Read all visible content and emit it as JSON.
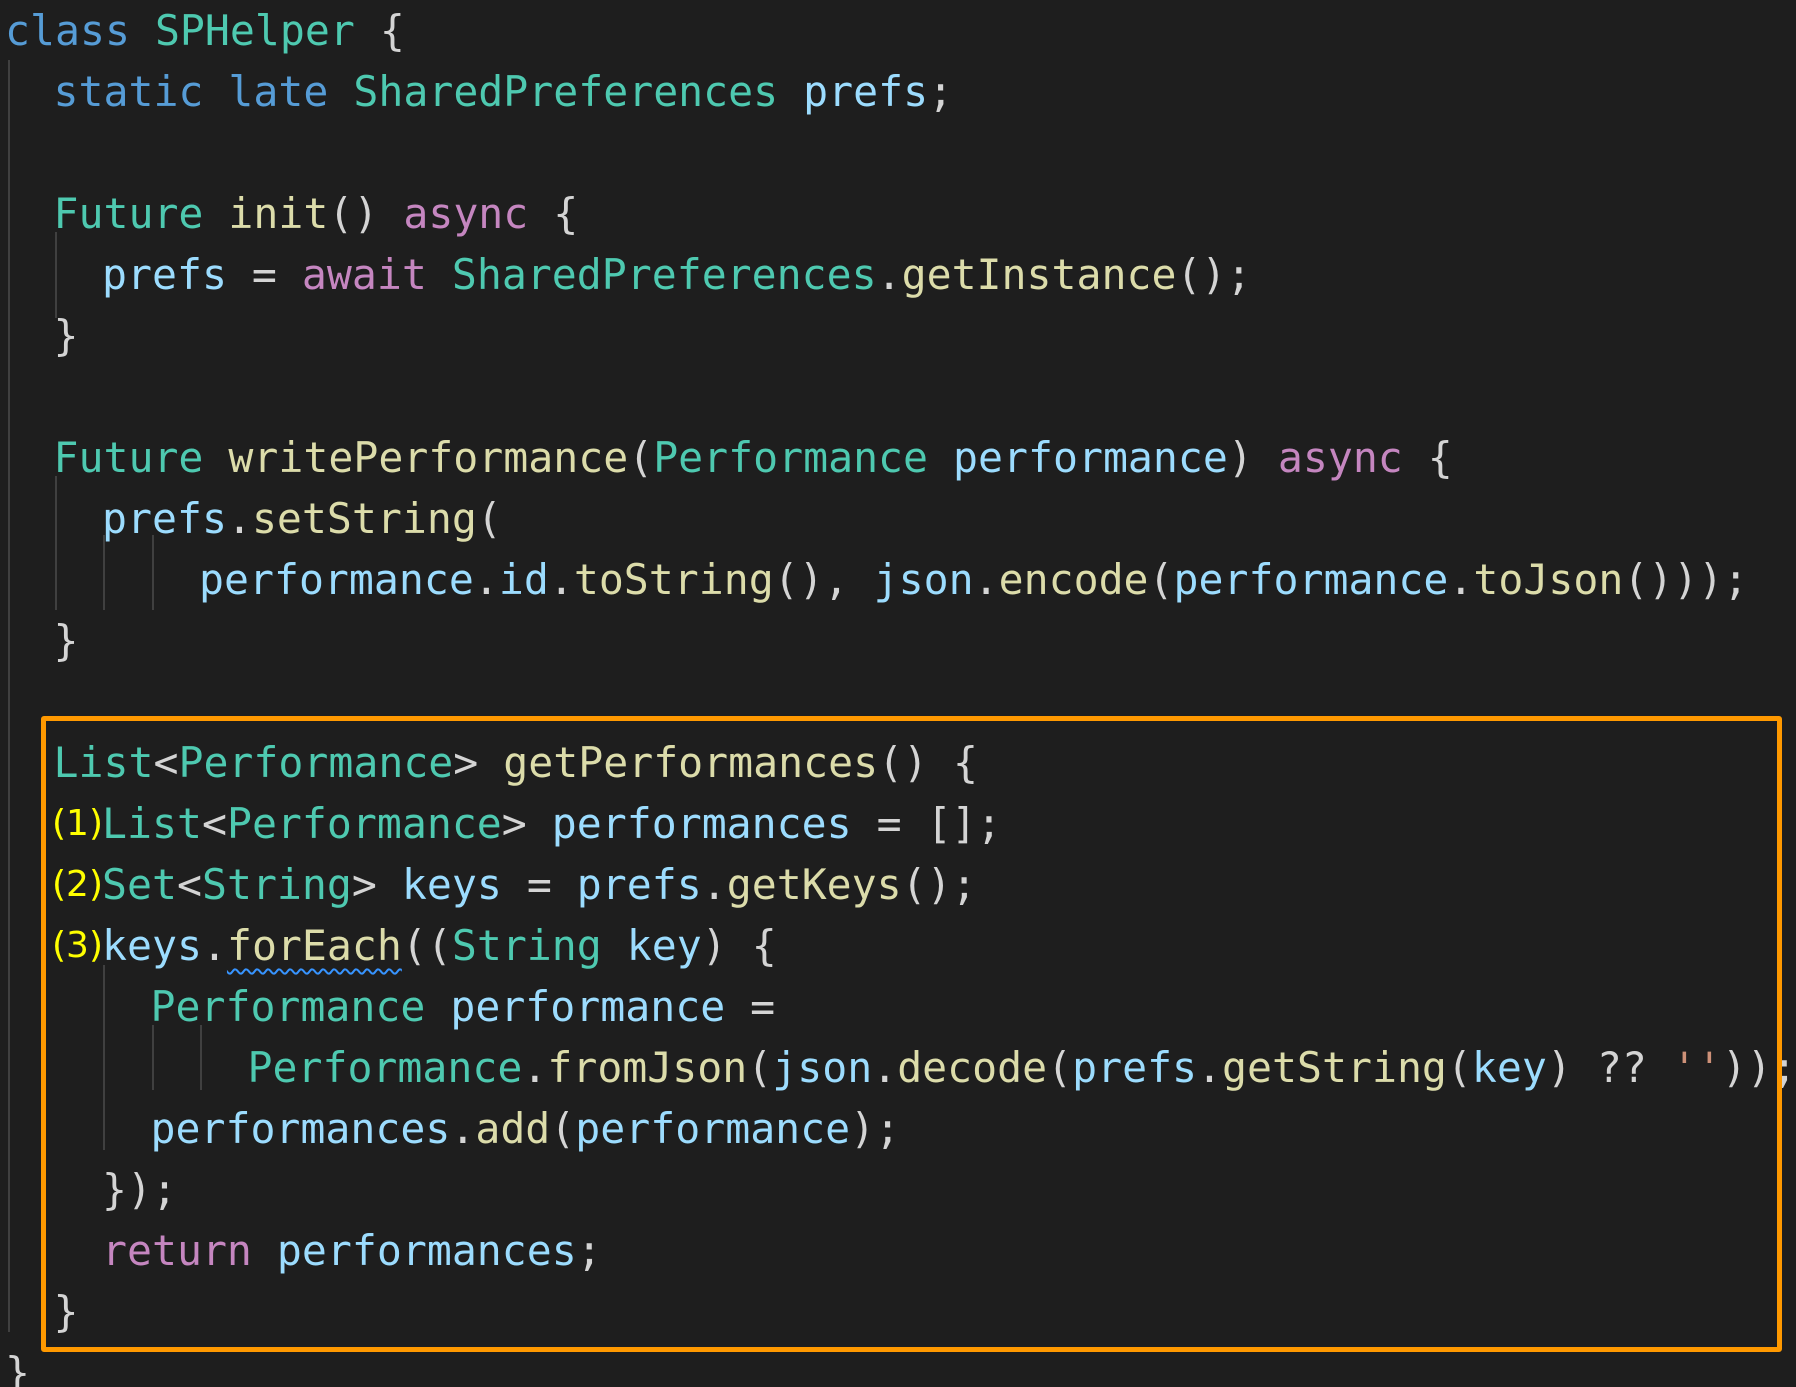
{
  "editor": {
    "colors": {
      "background": "#1e1e1e",
      "keyword": "#569cd6",
      "control_keyword": "#c586c0",
      "type": "#4ec9b0",
      "function": "#dcdcaa",
      "variable": "#9cdcfe",
      "punctuation": "#d4d4d4",
      "string": "#ce9178",
      "step_marker": "#ffff00",
      "highlight_border": "#ff9900"
    },
    "lines": [
      [
        [
          "kw",
          "class"
        ],
        [
          "p",
          " "
        ],
        [
          "ty",
          "SPHelper"
        ],
        [
          "p",
          " {"
        ]
      ],
      [
        [
          "kw",
          "static"
        ],
        [
          "p",
          " "
        ],
        [
          "kw",
          "late"
        ],
        [
          "p",
          " "
        ],
        [
          "ty",
          "SharedPreferences"
        ],
        [
          "p",
          " "
        ],
        [
          "v",
          "prefs"
        ],
        [
          "p",
          ";"
        ]
      ],
      [],
      [
        [
          "ty",
          "Future"
        ],
        [
          "p",
          " "
        ],
        [
          "fn",
          "init"
        ],
        [
          "p",
          "() "
        ],
        [
          "ck",
          "async"
        ],
        [
          "p",
          " {"
        ]
      ],
      [
        [
          "v",
          "prefs"
        ],
        [
          "p",
          " = "
        ],
        [
          "ck",
          "await"
        ],
        [
          "p",
          " "
        ],
        [
          "ty",
          "SharedPreferences"
        ],
        [
          "p",
          "."
        ],
        [
          "fn",
          "getInstance"
        ],
        [
          "p",
          "();"
        ]
      ],
      [
        [
          "p",
          "}"
        ]
      ],
      [],
      [
        [
          "ty",
          "Future"
        ],
        [
          "p",
          " "
        ],
        [
          "fn",
          "writePerformance"
        ],
        [
          "p",
          "("
        ],
        [
          "ty",
          "Performance"
        ],
        [
          "p",
          " "
        ],
        [
          "v",
          "performance"
        ],
        [
          "p",
          ") "
        ],
        [
          "ck",
          "async"
        ],
        [
          "p",
          " {"
        ]
      ],
      [
        [
          "v",
          "prefs"
        ],
        [
          "p",
          "."
        ],
        [
          "fn",
          "setString"
        ],
        [
          "p",
          "("
        ]
      ],
      [
        [
          "v",
          "performance"
        ],
        [
          "p",
          "."
        ],
        [
          "v",
          "id"
        ],
        [
          "p",
          "."
        ],
        [
          "fn",
          "toString"
        ],
        [
          "p",
          "(), "
        ],
        [
          "v",
          "json"
        ],
        [
          "p",
          "."
        ],
        [
          "fn",
          "encode"
        ],
        [
          "p",
          "("
        ],
        [
          "v",
          "performance"
        ],
        [
          "p",
          "."
        ],
        [
          "fn",
          "toJson"
        ],
        [
          "p",
          "()));"
        ]
      ],
      [
        [
          "p",
          "}"
        ]
      ],
      [],
      [
        [
          "ty",
          "List"
        ],
        [
          "p",
          "<"
        ],
        [
          "ty",
          "Performance"
        ],
        [
          "p",
          "> "
        ],
        [
          "fn",
          "getPerformances"
        ],
        [
          "p",
          "() {"
        ]
      ],
      [
        [
          "ty",
          "List"
        ],
        [
          "p",
          "<"
        ],
        [
          "ty",
          "Performance"
        ],
        [
          "p",
          "> "
        ],
        [
          "v",
          "performances"
        ],
        [
          "p",
          " = [];"
        ]
      ],
      [
        [
          "ty",
          "Set"
        ],
        [
          "p",
          "<"
        ],
        [
          "ty",
          "String"
        ],
        [
          "p",
          "> "
        ],
        [
          "v",
          "keys"
        ],
        [
          "p",
          " = "
        ],
        [
          "v",
          "prefs"
        ],
        [
          "p",
          "."
        ],
        [
          "fn",
          "getKeys"
        ],
        [
          "p",
          "();"
        ]
      ],
      [
        [
          "v",
          "keys"
        ],
        [
          "p",
          "."
        ],
        [
          "sq",
          "forEach"
        ],
        [
          "p",
          "(("
        ],
        [
          "ty",
          "String"
        ],
        [
          "p",
          " "
        ],
        [
          "v",
          "key"
        ],
        [
          "p",
          ") {"
        ]
      ],
      [
        [
          "ty",
          "Performance"
        ],
        [
          "p",
          " "
        ],
        [
          "v",
          "performance"
        ],
        [
          "p",
          " ="
        ]
      ],
      [
        [
          "ty",
          "Performance"
        ],
        [
          "p",
          "."
        ],
        [
          "fn",
          "fromJson"
        ],
        [
          "p",
          "("
        ],
        [
          "v",
          "json"
        ],
        [
          "p",
          "."
        ],
        [
          "fn",
          "decode"
        ],
        [
          "p",
          "("
        ],
        [
          "v",
          "prefs"
        ],
        [
          "p",
          "."
        ],
        [
          "fn",
          "getString"
        ],
        [
          "p",
          "("
        ],
        [
          "v",
          "key"
        ],
        [
          "p",
          ") ?? "
        ],
        [
          "s",
          "''"
        ],
        [
          "p",
          "));"
        ]
      ],
      [
        [
          "v",
          "performances"
        ],
        [
          "p",
          "."
        ],
        [
          "fn",
          "add"
        ],
        [
          "p",
          "("
        ],
        [
          "v",
          "performance"
        ],
        [
          "p",
          ");"
        ]
      ],
      [
        [
          "p",
          "});"
        ]
      ],
      [
        [
          "ck",
          "return"
        ],
        [
          "p",
          " "
        ],
        [
          "v",
          "performances"
        ],
        [
          "p",
          ";"
        ]
      ],
      [
        [
          "p",
          "}"
        ]
      ],
      [
        [
          "p",
          "}"
        ]
      ]
    ],
    "step_markers": [
      {
        "line": 13,
        "label": "(1)"
      },
      {
        "line": 14,
        "label": "(2)"
      },
      {
        "line": 15,
        "label": "(3)"
      }
    ]
  }
}
